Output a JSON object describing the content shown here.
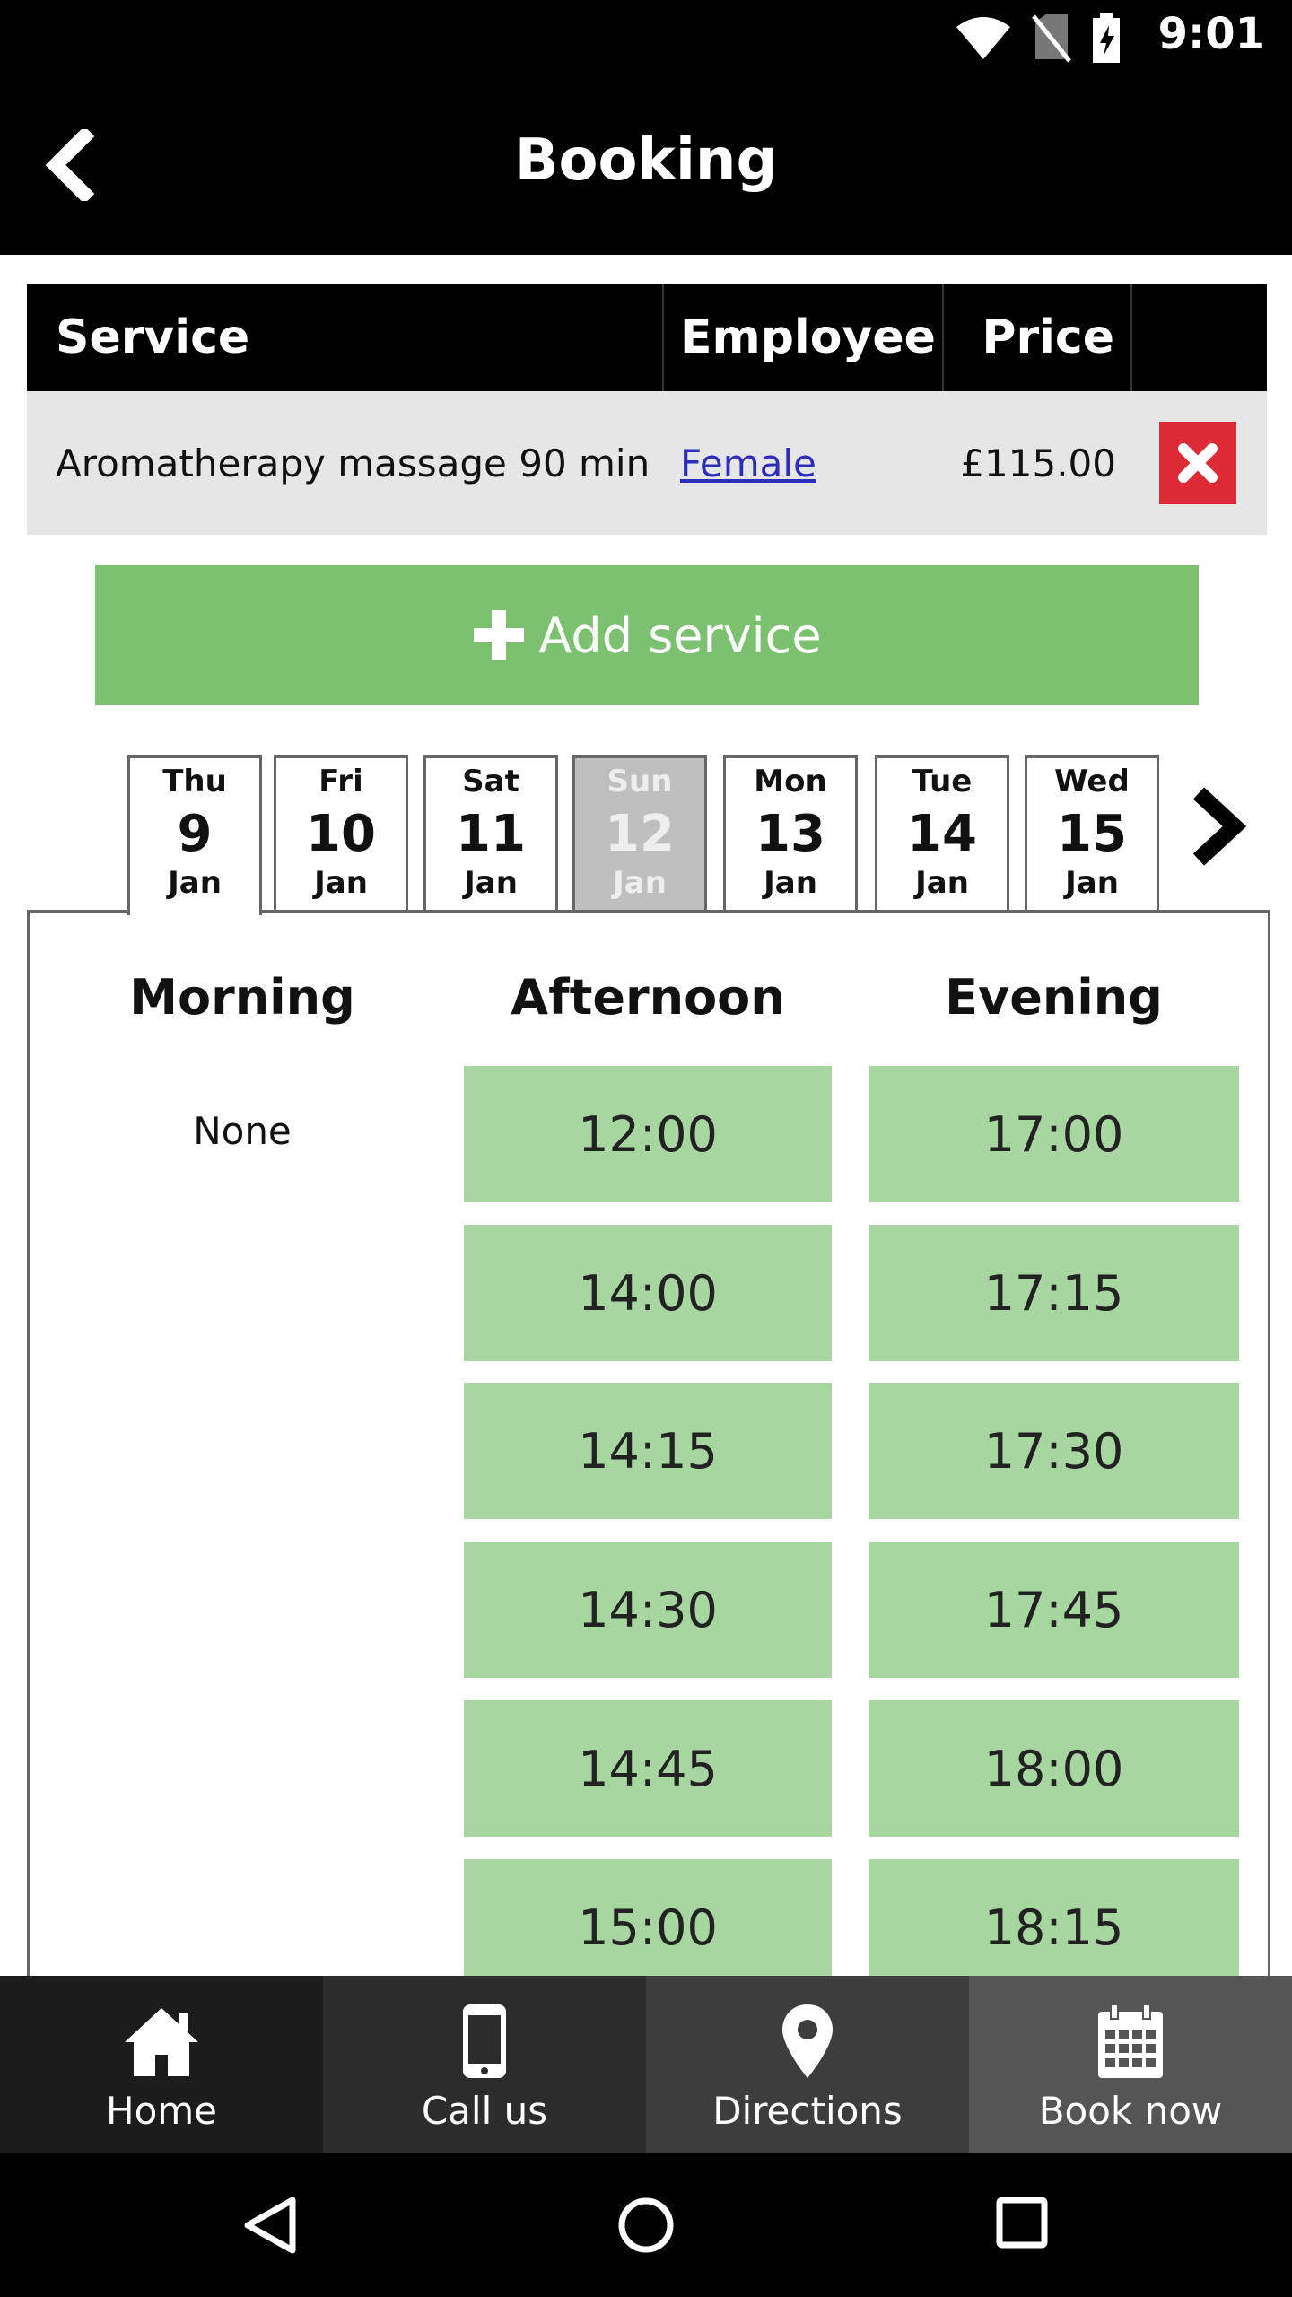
{
  "status_bar": {
    "time": "9:01"
  },
  "header": {
    "title": "Booking"
  },
  "service_table": {
    "headers": {
      "service": "Service",
      "employee": "Employee",
      "price": "Price"
    },
    "row": {
      "service": "Aromatherapy massage 90 min",
      "employee": "Female",
      "price": "£115.00"
    }
  },
  "add_service": {
    "label": "Add service"
  },
  "date_tabs": [
    {
      "dow": "Thu",
      "day": "9",
      "month": "Jan",
      "state": "selected"
    },
    {
      "dow": "Fri",
      "day": "10",
      "month": "Jan",
      "state": "normal"
    },
    {
      "dow": "Sat",
      "day": "11",
      "month": "Jan",
      "state": "normal"
    },
    {
      "dow": "Sun",
      "day": "12",
      "month": "Jan",
      "state": "disabled"
    },
    {
      "dow": "Mon",
      "day": "13",
      "month": "Jan",
      "state": "normal"
    },
    {
      "dow": "Tue",
      "day": "14",
      "month": "Jan",
      "state": "normal"
    },
    {
      "dow": "Wed",
      "day": "15",
      "month": "Jan",
      "state": "normal"
    }
  ],
  "periods": {
    "morning": {
      "title": "Morning",
      "empty_text": "None"
    },
    "afternoon": {
      "title": "Afternoon",
      "slots": [
        "12:00",
        "14:00",
        "14:15",
        "14:30",
        "14:45",
        "15:00"
      ]
    },
    "evening": {
      "title": "Evening",
      "slots": [
        "17:00",
        "17:15",
        "17:30",
        "17:45",
        "18:00",
        "18:15"
      ]
    }
  },
  "bottom_nav": [
    {
      "label": "Home",
      "icon": "home-icon",
      "bg": "#1c1c1c"
    },
    {
      "label": "Call us",
      "icon": "phone-icon",
      "bg": "#2c2c2c"
    },
    {
      "label": "Directions",
      "icon": "map-pin-icon",
      "bg": "#3d3d3d"
    },
    {
      "label": "Book now",
      "icon": "calendar-icon",
      "bg": "#555555"
    }
  ],
  "colors": {
    "accent_green": "#7cc16f",
    "slot_green": "#a7d6a0",
    "delete_red": "#dd2b36",
    "link_blue": "#2d2dbb"
  }
}
